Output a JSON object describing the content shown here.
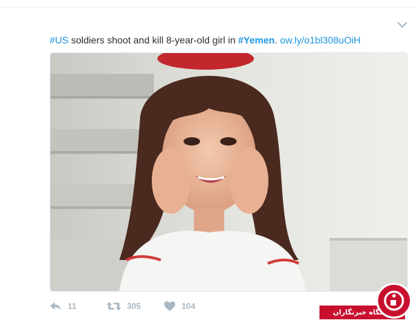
{
  "tweet": {
    "text": {
      "hashtag_us": "#US",
      "body": " soldiers shoot and kill 8-year-old girl in ",
      "hashtag_yemen": "#Yemen",
      "after": ". ",
      "link": "ow.ly/o1bl308uOiH"
    },
    "media": {
      "alt": "Photo of a young girl with brown hair resting her face on her hands, smiling"
    },
    "actions": {
      "reply_count": "11",
      "retweet_count": "305",
      "like_count": "104"
    }
  },
  "watermark": {
    "label": "باشگاه خبرنگاران"
  },
  "icons": {
    "menu": "chevron-down-icon",
    "reply": "reply-icon",
    "retweet": "retweet-icon",
    "like": "heart-icon",
    "watermark": "news-agency-logo"
  },
  "colors": {
    "link": "#1b95e0",
    "text": "#292f33",
    "action_gray": "#aab8c2",
    "watermark_red": "#c8102e"
  }
}
